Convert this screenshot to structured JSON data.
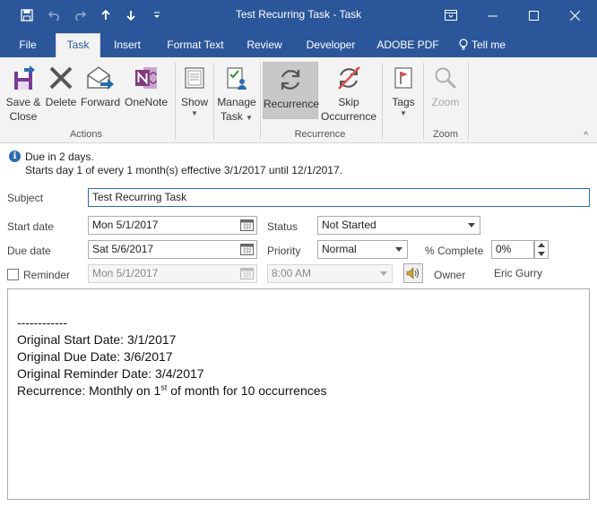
{
  "window": {
    "title": "Test Recurring Task  -  Task",
    "minimize_glyph": "—",
    "maximize_glyph": "☐",
    "close_glyph": "✕"
  },
  "qat": {
    "save_icon": "save-icon",
    "undo_icon": "undo-icon",
    "redo_icon": "redo-icon",
    "up_glyph": "🡑",
    "down_glyph": "🡓",
    "customize_glyph": "⇟"
  },
  "tabs": [
    {
      "label": "File"
    },
    {
      "label": "Task"
    },
    {
      "label": "Insert"
    },
    {
      "label": "Format Text"
    },
    {
      "label": "Review"
    },
    {
      "label": "Developer"
    },
    {
      "label": "ADOBE PDF"
    },
    {
      "label": "Tell me"
    }
  ],
  "ribbon": {
    "actions": {
      "save_close": [
        "Save &",
        "Close"
      ],
      "delete": "Delete",
      "forward": "Forward",
      "onenote": "OneNote",
      "group_label": "Actions"
    },
    "show": {
      "label": "Show"
    },
    "manage_task": {
      "label": [
        "Manage",
        "Task"
      ]
    },
    "recurrence": {
      "recurrence": "Recurrence",
      "skip": [
        "Skip",
        "Occurrence"
      ],
      "group_label": "Recurrence"
    },
    "tags": {
      "label": "Tags"
    },
    "zoom": {
      "label": "Zoom",
      "group_label": "Zoom"
    },
    "collapse_glyph": "^"
  },
  "info": {
    "line1": "Due in 2 days.",
    "line2": "Starts day 1 of every 1 month(s) effective 3/1/2017 until 12/1/2017."
  },
  "form": {
    "subject_label": "Subject",
    "subject_value": "Test Recurring Task",
    "start_label": "Start date",
    "start_value": "Mon 5/1/2017",
    "due_label": "Due date",
    "due_value": "Sat 5/6/2017",
    "status_label": "Status",
    "status_value": "Not Started",
    "priority_label": "Priority",
    "priority_value": "Normal",
    "complete_label": "% Complete",
    "complete_value": "0%",
    "reminder_label": "Reminder",
    "reminder_date": "Mon 5/1/2017",
    "reminder_time": "8:00 AM",
    "owner_label": "Owner",
    "owner_value": "Eric Gurry"
  },
  "notes": {
    "divider": "------------",
    "line1": "Original Start Date: 3/1/2017",
    "line2": "Original Due Date: 3/6/2017",
    "line3": "Original Reminder Date: 3/4/2017",
    "line4_pre": "Recurrence: Monthly on 1",
    "line4_sup": "st",
    "line4_post": " of month for 10 occurrences"
  },
  "colors": {
    "titlebar": "#2b579a",
    "ribbon": "#f3f3f3",
    "accent": "#2b6cb0",
    "onenote": "#80397b",
    "delete": "#555555"
  }
}
